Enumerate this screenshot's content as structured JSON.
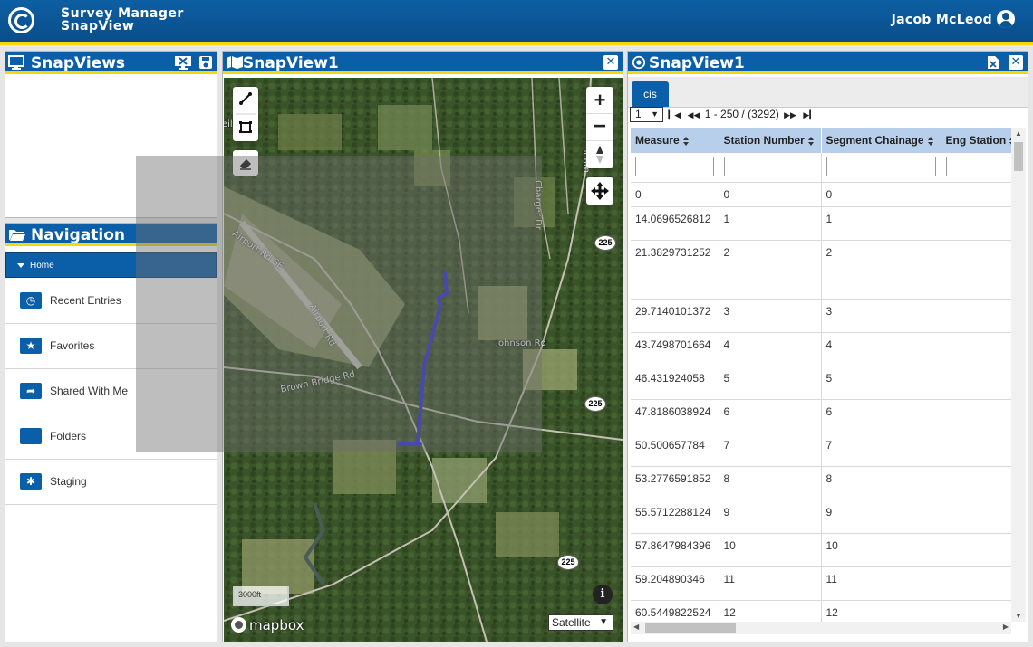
{
  "app": {
    "title_line1": "Survey Manager",
    "title_line2": "SnapView",
    "user": "Jacob McLeod"
  },
  "snapviews_panel": {
    "title": "SnapViews"
  },
  "navigation_panel": {
    "title": "Navigation",
    "home_label": "Home",
    "items": [
      {
        "label": "Recent Entries",
        "icon": "clock-folder-icon"
      },
      {
        "label": "Favorites",
        "icon": "star-folder-icon"
      },
      {
        "label": "Shared With Me",
        "icon": "share-folder-icon"
      },
      {
        "label": "Folders",
        "icon": "folder-icon"
      },
      {
        "label": "Staging",
        "icon": "asterisk-folder-icon"
      }
    ]
  },
  "map_panel": {
    "title": "SnapView1",
    "scale": "3000ft",
    "attribution": "mapbox",
    "basemap": "Satellite",
    "road_labels": [
      "Airport Rd SE",
      "Airport Rd",
      "Brown Bridge Rd",
      "Johnson Rd",
      "Charger Dr",
      "Tonto"
    ],
    "shields": [
      "225",
      "225",
      "225"
    ],
    "partial_text": "eill"
  },
  "table_panel": {
    "title": "SnapView1",
    "tab": "cis",
    "page_select": "1",
    "range": "1 - 250 / (3292)",
    "columns": [
      "Measure",
      "Station Number",
      "Segment Chainage",
      "Eng Station"
    ],
    "rows": [
      [
        "0",
        "0",
        "0",
        ""
      ],
      [
        "14.0696526812",
        "1",
        "1",
        ""
      ],
      [
        "21.3829731252",
        "2",
        "2",
        ""
      ],
      [
        "29.7140101372",
        "3",
        "3",
        ""
      ],
      [
        "43.7498701664",
        "4",
        "4",
        ""
      ],
      [
        "46.431924058",
        "5",
        "5",
        ""
      ],
      [
        "47.8186038924",
        "6",
        "6",
        ""
      ],
      [
        "50.500657784",
        "7",
        "7",
        ""
      ],
      [
        "53.2776591852",
        "8",
        "8",
        ""
      ],
      [
        "55.5712288124",
        "9",
        "9",
        ""
      ],
      [
        "57.8647984396",
        "10",
        "10",
        ""
      ],
      [
        "59.204890346",
        "11",
        "11",
        ""
      ],
      [
        "60.5449822524",
        "12",
        "12",
        ""
      ]
    ]
  },
  "colors": {
    "header_blue": "#0b5ea8",
    "accent_yellow": "#f5d80a",
    "route_blue": "#2a2adf"
  }
}
